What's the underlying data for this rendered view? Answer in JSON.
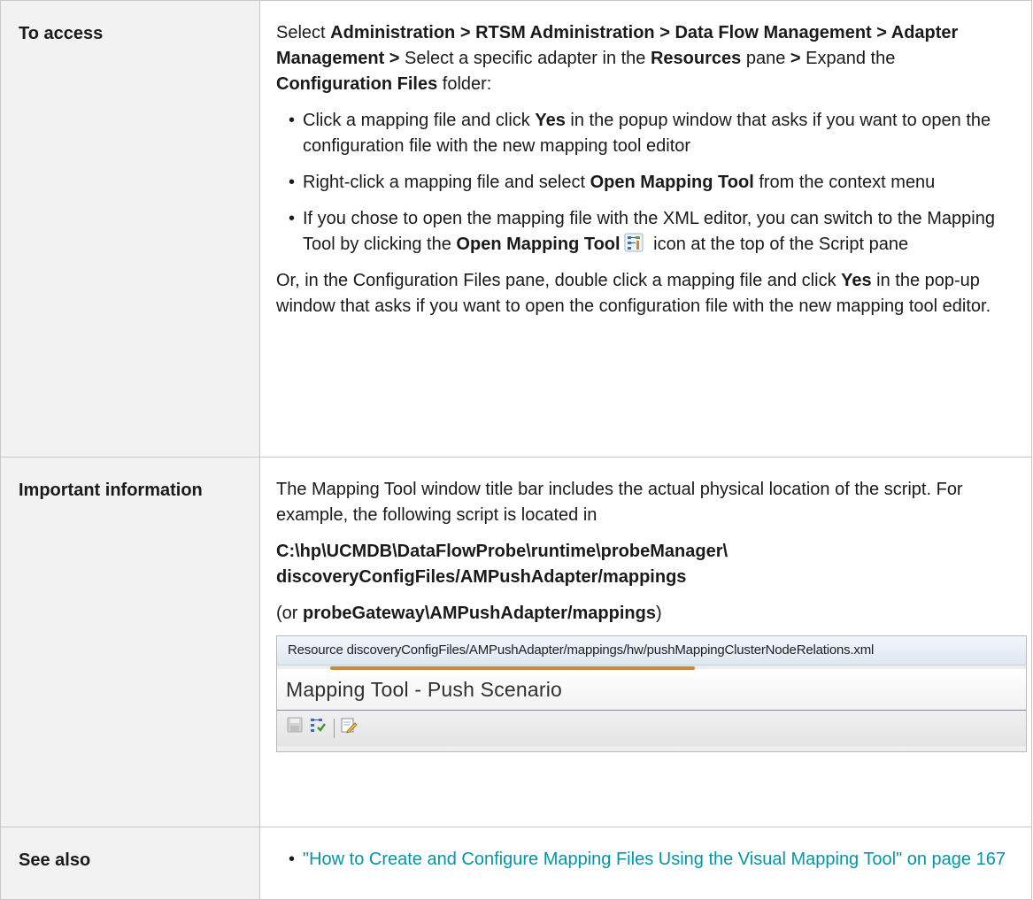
{
  "rows": {
    "access": {
      "label": "To access",
      "intro": {
        "t1": "Select ",
        "b1": "Administration > RTSM Administration > Data Flow Management > Adapter Management >",
        "t2": "  Select a specific adapter in the ",
        "b2": "Resources",
        "t3": " pane ",
        "b3": ">",
        "t4": " Expand the ",
        "b4": "Configuration Files",
        "t5": " folder:"
      },
      "bullets": [
        {
          "t1": "Click a mapping file and click ",
          "b1": "Yes",
          "t2": " in the popup window that asks if you want to open the configuration file with the new mapping tool editor"
        },
        {
          "t1": "Right-click a mapping file and select ",
          "b1": "Open Mapping Tool",
          "t2": " from the context menu"
        },
        {
          "t1": "If you chose to open the mapping file with the XML editor, you can switch to the Mapping Tool by clicking the ",
          "b1": "Open Mapping Tool",
          "t2": " icon at the top of the Script pane"
        }
      ],
      "outro": {
        "t1": "Or, in the Configuration Files pane, double click a mapping file and click ",
        "b1": "Yes",
        "t2": " in the pop-up window that asks if you want to open the configuration file with the new mapping tool editor."
      }
    },
    "important": {
      "label": "Important information",
      "p1": "The Mapping Tool window title bar includes the actual physical location of the script. For example, the following script is located in",
      "path": "C:\\hp\\UCMDB\\DataFlowProbe\\runtime\\probeManager\\ discoveryConfigFiles/AMPushAdapter/mappings",
      "alt_t1": "(or ",
      "alt_b1": "probeGateway\\AMPushAdapter/mappings",
      "alt_t2": ")",
      "screenshot": {
        "resource_text": "Resource discoveryConfigFiles/AMPushAdapter/mappings/hw/pushMappingClusterNodeRelations.xml",
        "window_title": "Mapping Tool - Push Scenario",
        "toolbar_icons": [
          "save-icon",
          "open-mapping-tool-icon",
          "edit-script-icon"
        ]
      }
    },
    "see_also": {
      "label": "See also",
      "link": "\"How to Create and Configure Mapping Files Using the Visual Mapping Tool\" on page 167"
    }
  },
  "colors": {
    "link": "#0096a8",
    "label_bg": "#f2f2f2",
    "border": "#c7c7c7",
    "underline": "#c98a3c"
  }
}
